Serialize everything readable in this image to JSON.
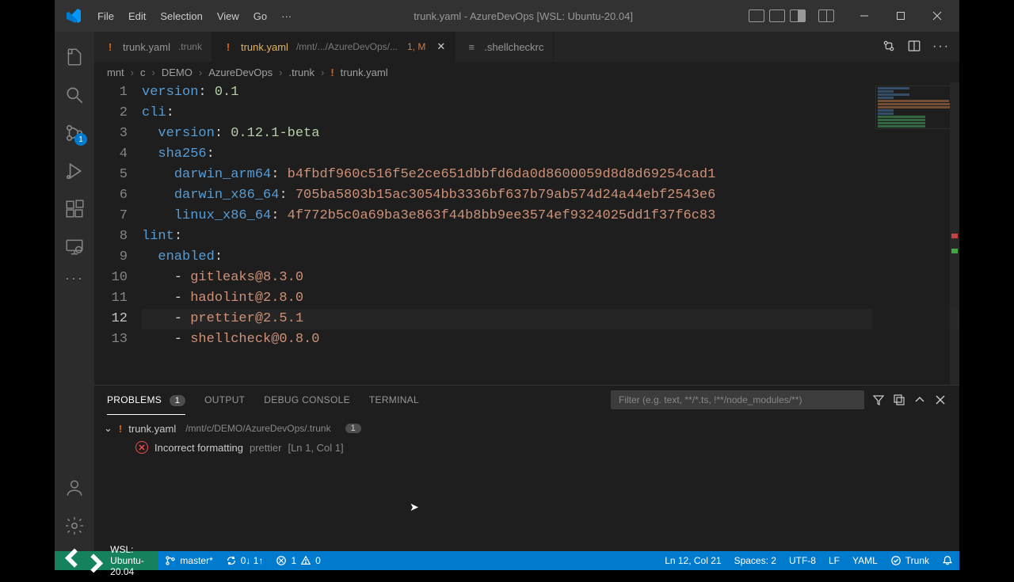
{
  "title": "trunk.yaml - AzureDevOps [WSL: Ubuntu-20.04]",
  "menu": [
    "File",
    "Edit",
    "Selection",
    "View",
    "Go",
    "···"
  ],
  "activity": {
    "scm_badge": "1"
  },
  "tabs": [
    {
      "icon": "!",
      "name": "trunk.yaml",
      "sub": ".trunk",
      "active": false
    },
    {
      "icon": "!",
      "name": "trunk.yaml",
      "sub": "/mnt/.../AzureDevOps/...",
      "problems": "1, M",
      "active": true
    },
    {
      "icon": "≡",
      "name": ".shellcheckrc",
      "sub": "",
      "active": false
    }
  ],
  "breadcrumb": [
    "mnt",
    "c",
    "DEMO",
    "AzureDevOps",
    ".trunk",
    "trunk.yaml"
  ],
  "code": {
    "lines": [
      {
        "n": 1,
        "seg": [
          [
            "k",
            "version"
          ],
          [
            "p",
            ": "
          ],
          [
            "n",
            "0.1"
          ]
        ]
      },
      {
        "n": 2,
        "seg": [
          [
            "k",
            "cli"
          ],
          [
            "p",
            ":"
          ]
        ]
      },
      {
        "n": 3,
        "seg": [
          [
            "p",
            "  "
          ],
          [
            "k",
            "version"
          ],
          [
            "p",
            ": "
          ],
          [
            "n",
            "0.12.1-beta"
          ]
        ]
      },
      {
        "n": 4,
        "seg": [
          [
            "p",
            "  "
          ],
          [
            "k",
            "sha256"
          ],
          [
            "p",
            ":"
          ]
        ]
      },
      {
        "n": 5,
        "seg": [
          [
            "p",
            "    "
          ],
          [
            "k",
            "darwin_arm64"
          ],
          [
            "p",
            ": "
          ],
          [
            "s",
            "b4fbdf960c516f5e2ce651dbbfd6da0d8600059d8d8d69254cad1"
          ]
        ]
      },
      {
        "n": 6,
        "seg": [
          [
            "p",
            "    "
          ],
          [
            "k",
            "darwin_x86_64"
          ],
          [
            "p",
            ": "
          ],
          [
            "s",
            "705ba5803b15ac3054bb3336bf637b79ab574d24a44ebf2543e6"
          ]
        ]
      },
      {
        "n": 7,
        "seg": [
          [
            "p",
            "    "
          ],
          [
            "k",
            "linux_x86_64"
          ],
          [
            "p",
            ": "
          ],
          [
            "s",
            "4f772b5c0a69ba3e863f44b8bb9ee3574ef9324025dd1f37f6c83"
          ]
        ]
      },
      {
        "n": 8,
        "seg": [
          [
            "k",
            "lint"
          ],
          [
            "p",
            ":"
          ]
        ]
      },
      {
        "n": 9,
        "seg": [
          [
            "p",
            "  "
          ],
          [
            "k",
            "enabled"
          ],
          [
            "p",
            ":"
          ]
        ]
      },
      {
        "n": 10,
        "seg": [
          [
            "p",
            "    - "
          ],
          [
            "s",
            "gitleaks@8.3.0"
          ]
        ]
      },
      {
        "n": 11,
        "seg": [
          [
            "p",
            "    - "
          ],
          [
            "s",
            "hadolint@2.8.0"
          ]
        ]
      },
      {
        "n": 12,
        "seg": [
          [
            "p",
            "    - "
          ],
          [
            "s",
            "prettier@2.5.1"
          ]
        ]
      },
      {
        "n": 13,
        "seg": [
          [
            "p",
            "    - "
          ],
          [
            "s",
            "shellcheck@0.8.0"
          ]
        ]
      }
    ],
    "current_line": 12
  },
  "panel": {
    "tabs": {
      "problems": "PROBLEMS",
      "problems_count": "1",
      "output": "OUTPUT",
      "debug": "DEBUG CONSOLE",
      "terminal": "TERMINAL"
    },
    "filter_placeholder": "Filter (e.g. text, **/*.ts, !**/node_modules/**)",
    "file": {
      "name": "trunk.yaml",
      "path": "/mnt/c/DEMO/AzureDevOps/.trunk",
      "count": "1"
    },
    "item": {
      "msg": "Incorrect formatting",
      "src": "prettier",
      "loc": "[Ln 1, Col 1]"
    }
  },
  "status": {
    "remote": "WSL: Ubuntu-20.04",
    "branch": "master*",
    "sync": "0↓ 1↑",
    "errors": "1",
    "warnings": "0",
    "cursor": "Ln 12, Col 21",
    "spaces": "Spaces: 2",
    "encoding": "UTF-8",
    "eol": "LF",
    "lang": "YAML",
    "trunk": "Trunk"
  }
}
